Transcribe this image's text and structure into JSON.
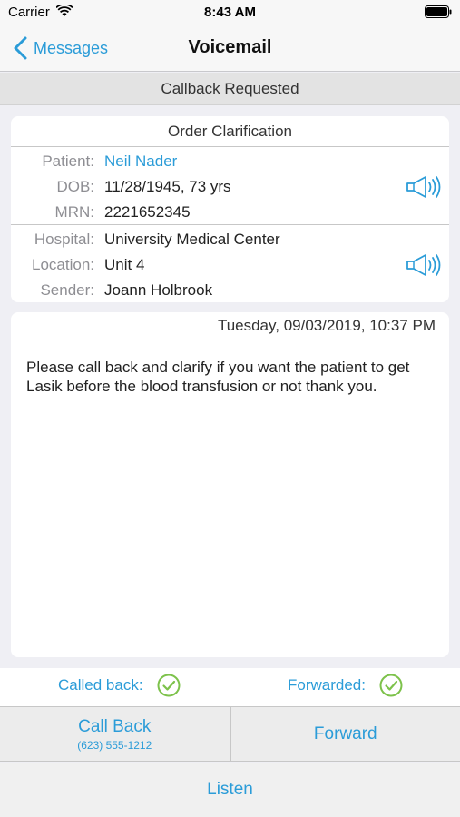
{
  "status_bar": {
    "carrier": "Carrier",
    "time": "8:43 AM"
  },
  "nav": {
    "back_label": "Messages",
    "title": "Voicemail"
  },
  "subheader": "Callback Requested",
  "info_card": {
    "title": "Order Clarification",
    "patient_label": "Patient:",
    "patient_value": "Neil Nader",
    "dob_label": "DOB:",
    "dob_value": "11/28/1945, 73 yrs",
    "mrn_label": "MRN:",
    "mrn_value": "2221652345",
    "hospital_label": "Hospital:",
    "hospital_value": "University Medical Center",
    "location_label": "Location:",
    "location_value": "Unit 4",
    "sender_label": "Sender:",
    "sender_value": "Joann Holbrook"
  },
  "message": {
    "date": "Tuesday, 09/03/2019, 10:37 PM",
    "text": "Please call back and clarify if you want the patient to get Lasik before the blood transfusion or not thank you."
  },
  "status": {
    "called_back_label": "Called back:",
    "forwarded_label": "Forwarded:"
  },
  "actions": {
    "call_back_label": "Call Back",
    "call_back_number": "(623) 555-1212",
    "forward_label": "Forward",
    "listen_label": "Listen"
  },
  "colors": {
    "accent": "#2b9cd8",
    "check": "#7dc24b"
  },
  "icons": [
    "wifi-icon",
    "battery-icon",
    "back-chevron-icon",
    "speaker-icon",
    "check-icon"
  ]
}
